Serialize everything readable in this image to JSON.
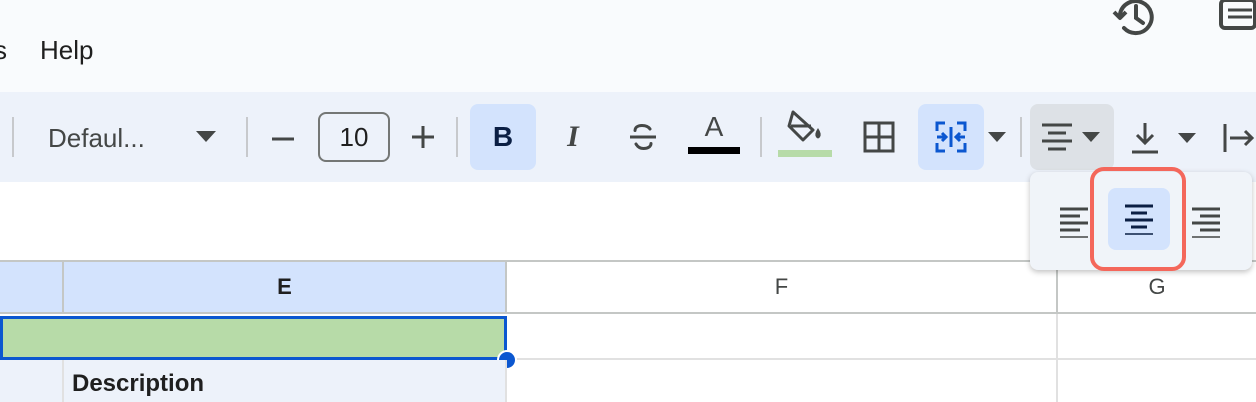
{
  "menu": {
    "partial_label": "s",
    "help_label": "Help"
  },
  "toolbar": {
    "font_name": "Defaul...",
    "font_size": "10",
    "bold_label": "B",
    "italic_label": "I",
    "text_color_label": "A",
    "text_color": "#000000",
    "fill_color": "#b7dba8",
    "active_color": "#d3e3fd"
  },
  "icons": {
    "history": "history-icon",
    "comments": "comments-icon",
    "minus": "minus-icon",
    "plus": "plus-icon",
    "strikethrough": "strikethrough-icon",
    "fill": "paint-bucket-icon",
    "borders": "borders-icon",
    "merge": "merge-cells-icon",
    "h_align": "align-center-icon",
    "v_align": "vertical-align-bottom-icon",
    "wrap": "text-wrap-icon"
  },
  "columns": [
    {
      "label": "E",
      "selected": true
    },
    {
      "label": "F",
      "selected": false
    },
    {
      "label": "G",
      "selected": false
    }
  ],
  "cells": {
    "description": "Description"
  },
  "align_menu": {
    "options": [
      "left",
      "center",
      "right"
    ],
    "selected": "center",
    "highlight_color": "#f4675b"
  }
}
